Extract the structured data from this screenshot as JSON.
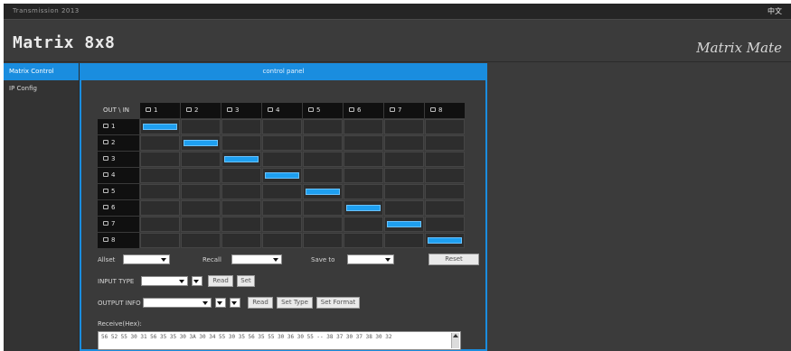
{
  "window": {
    "title_tab": "Transmission  2013",
    "lang_icon": "language-icon",
    "lang_text": "中文"
  },
  "header": {
    "title": "Matrix 8x8",
    "brand": "Matrix Mate"
  },
  "sidebar": {
    "items": [
      {
        "label": "Matrix Control",
        "active": true
      },
      {
        "label": "IP Config",
        "active": false
      }
    ]
  },
  "panel": {
    "header": "control panel"
  },
  "matrix": {
    "corner_label": "OUT \\ IN",
    "inputs": [
      "1",
      "2",
      "3",
      "4",
      "5",
      "6",
      "7",
      "8"
    ],
    "outputs": [
      "1",
      "2",
      "3",
      "4",
      "5",
      "6",
      "7",
      "8"
    ],
    "routes": [
      1,
      2,
      3,
      4,
      5,
      6,
      7,
      8
    ],
    "active_color": "#1e9ff0"
  },
  "controls": {
    "all_label": "Allset",
    "all_value": "",
    "recall_label": "Recall",
    "recall_value": "",
    "save_label": "Save to",
    "save_value": "",
    "reset_label": "Reset",
    "input_type_label": "INPUT TYPE",
    "input_type_value": "",
    "input_type_sub": "",
    "read_input": "Read",
    "set_input": "Set",
    "output_info_label": "OUTPUT INFO",
    "output_info_value": "",
    "output_info_sub1": "",
    "output_info_sub2": "",
    "read_output": "Read",
    "set_type": "Set Type",
    "set_format": "Set Format"
  },
  "receive": {
    "label": "Receive(Hex):",
    "text": "56 52 55 30 31 56 35 35 30 3A 30 34 55 30 35 56 35 55 30 36 30 55 -- 38 37 30 37 38 30 32"
  },
  "colors": {
    "accent": "#1a8ddf",
    "background": "#3b3b3b"
  }
}
